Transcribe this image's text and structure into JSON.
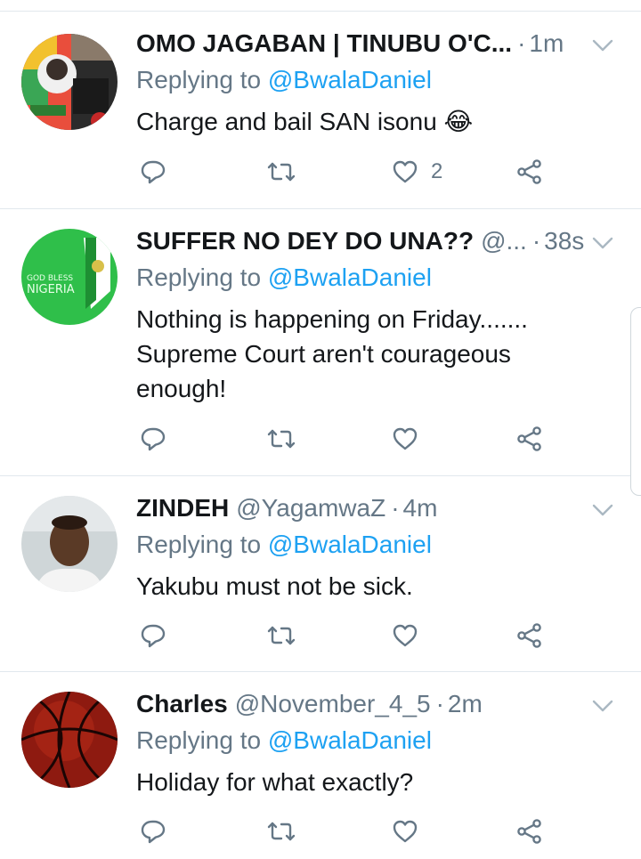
{
  "tweets": [
    {
      "name": "OMO JAGABAN | TINUBU O'C...",
      "handle": "",
      "time": "1m",
      "replying_prefix": "Replying to",
      "replying_to": "@BwalaDaniel",
      "text": "Charge and bail SAN isonu 😂",
      "like_count": "2",
      "avatar": "jagaban-avatar"
    },
    {
      "name": "SUFFER NO DEY DO UNA??",
      "handle": "@...",
      "time": "38s",
      "replying_prefix": "Replying to",
      "replying_to": "@BwalaDaniel",
      "text": "Nothing is happening on Friday....... Supreme Court aren't courageous enough!",
      "like_count": "",
      "avatar_text": "GOD BLESS\nNIGERIA"
    },
    {
      "name": "ZINDEH",
      "handle": "@YagamwaZ",
      "time": "4m",
      "replying_prefix": "Replying to",
      "replying_to": "@BwalaDaniel",
      "text": "Yakubu must not be sick.",
      "like_count": "",
      "avatar": "man-photo-avatar"
    },
    {
      "name": "Charles",
      "handle": "@November_4_5",
      "time": "2m",
      "replying_prefix": "Replying to",
      "replying_to": "@BwalaDaniel",
      "text": "Holiday for what exactly?",
      "like_count": "",
      "avatar": "basketball-avatar"
    }
  ],
  "icons": [
    "reply-icon",
    "retweet-icon",
    "like-icon",
    "share-icon",
    "chevron-down-icon"
  ],
  "colors": {
    "accent": "#1da1f2",
    "muted": "#657786",
    "text": "#14171a",
    "divider": "#e1e8ed"
  }
}
